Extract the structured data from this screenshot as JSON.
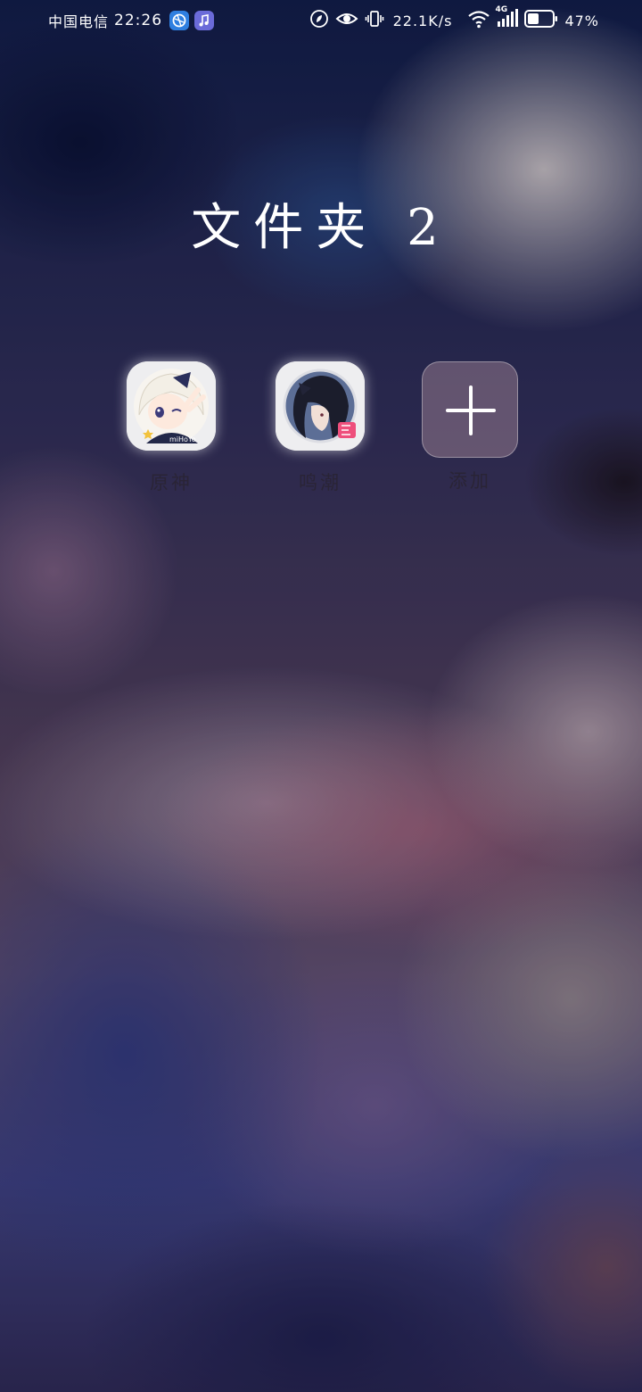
{
  "status_bar": {
    "carrier": "中国电信",
    "time": "22:26",
    "network_speed": "22.1K/s",
    "network_type": "4G",
    "battery_percent": "47%",
    "battery_level": 0.47
  },
  "folder": {
    "title": "文件夹 2",
    "apps": [
      {
        "label": "原神",
        "icon": "genshin-app-icon"
      },
      {
        "label": "鸣潮",
        "icon": "wuthering-waves-app-icon"
      }
    ],
    "add_label": "添加",
    "genshin_icon_text": "miHoYo"
  },
  "colors": {
    "status_text": "#ffffff",
    "label_text": "#3a3340"
  }
}
